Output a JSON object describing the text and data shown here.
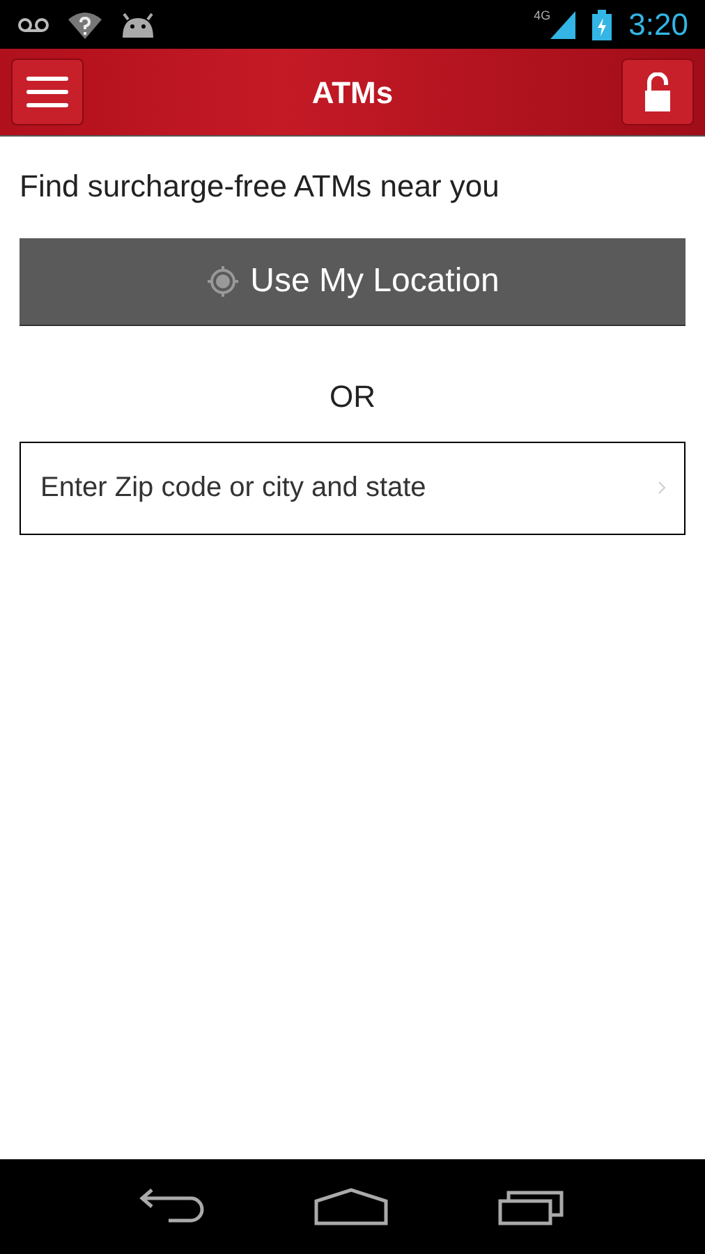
{
  "status_bar": {
    "network": "4G",
    "time": "3:20"
  },
  "header": {
    "title": "ATMs"
  },
  "heading": "Find surcharge-free ATMs near you",
  "location_button": {
    "label": "Use My Location"
  },
  "separator": "OR",
  "search": {
    "placeholder": "Enter Zip code or city and state"
  }
}
